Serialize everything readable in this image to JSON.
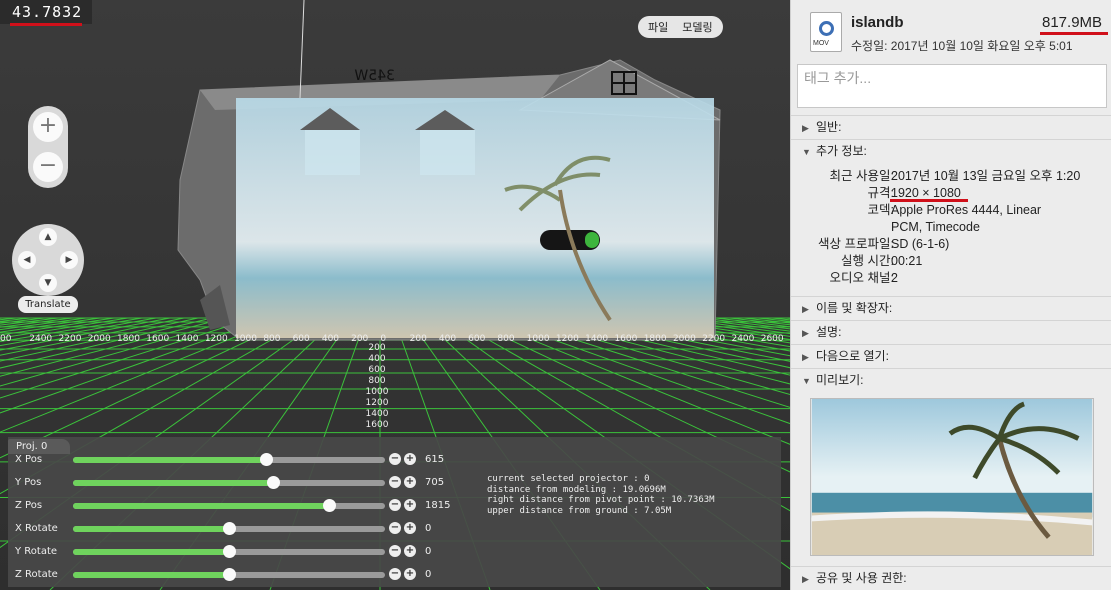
{
  "viewer": {
    "fps_readout": "43.7832",
    "menu": {
      "file": "파일",
      "modeling": "모델링"
    },
    "zoom": {
      "in": "+",
      "out": "−"
    },
    "translate_label": "Translate",
    "x_axis_labels": [
      "00",
      "2400",
      "2200",
      "2000",
      "1800",
      "1600",
      "1400",
      "1200",
      "1000",
      "800",
      "600",
      "400",
      "200",
      "0",
      "200",
      "400",
      "600",
      "800",
      "1000",
      "1200",
      "1400",
      "1600",
      "1800",
      "2000",
      "2200",
      "2400",
      "2600"
    ],
    "z_axis_labels": [
      "200",
      "400",
      "600",
      "800",
      "1000",
      "1200",
      "1400",
      "1600"
    ],
    "projector_tab": "Proj. 0",
    "controls": [
      {
        "label": "X Pos",
        "value": "615",
        "level": 0.62
      },
      {
        "label": "Y Pos",
        "value": "705",
        "level": 0.64
      },
      {
        "label": "Z Pos",
        "value": "1815",
        "level": 0.82
      },
      {
        "label": "X Rotate",
        "value": "0",
        "level": 0.5
      },
      {
        "label": "Y Rotate",
        "value": "0",
        "level": 0.5
      },
      {
        "label": "Z Rotate",
        "value": "0",
        "level": 0.5
      }
    ],
    "info_lines": [
      "current selected projector : 0",
      "distance from modeling : 19.0696M",
      "right distance from pivot point : 10.7363M",
      "upper distance from ground : 7.05M"
    ],
    "house_sign": "345W",
    "colors": {
      "accent_red": "#d0101a",
      "slider_green": "#6fd35d",
      "grid_green": "#3cd23c"
    }
  },
  "inspector": {
    "file_icon_ext": "MOV",
    "file_name": "islandb",
    "file_size": "817.9MB",
    "modified": "수정일:  2017년 10월 10일 화요일 오후 5:01",
    "tags_placeholder": "태그 추가...",
    "sections": {
      "general": "일반:",
      "more_info": "추가 정보:",
      "name_ext": "이름 및 확장자:",
      "comments": "설명:",
      "open_with": "다음으로 열기:",
      "preview": "미리보기:",
      "sharing": "공유 및 사용 권한:"
    },
    "details": [
      {
        "key": "최근 사용일:",
        "value": "2017년 10월 13일 금요일 오후 1:20"
      },
      {
        "key": "규격:",
        "value": "1920 × 1080"
      },
      {
        "key": "코덱:",
        "value": "Apple ProRes 4444, Linear"
      },
      {
        "key": "",
        "value": "PCM, Timecode"
      },
      {
        "key": "색상 프로파일:",
        "value": "SD (6-1-6)"
      },
      {
        "key": "실행 시간:",
        "value": "00:21"
      },
      {
        "key": "오디오 채널:",
        "value": "2"
      }
    ]
  }
}
